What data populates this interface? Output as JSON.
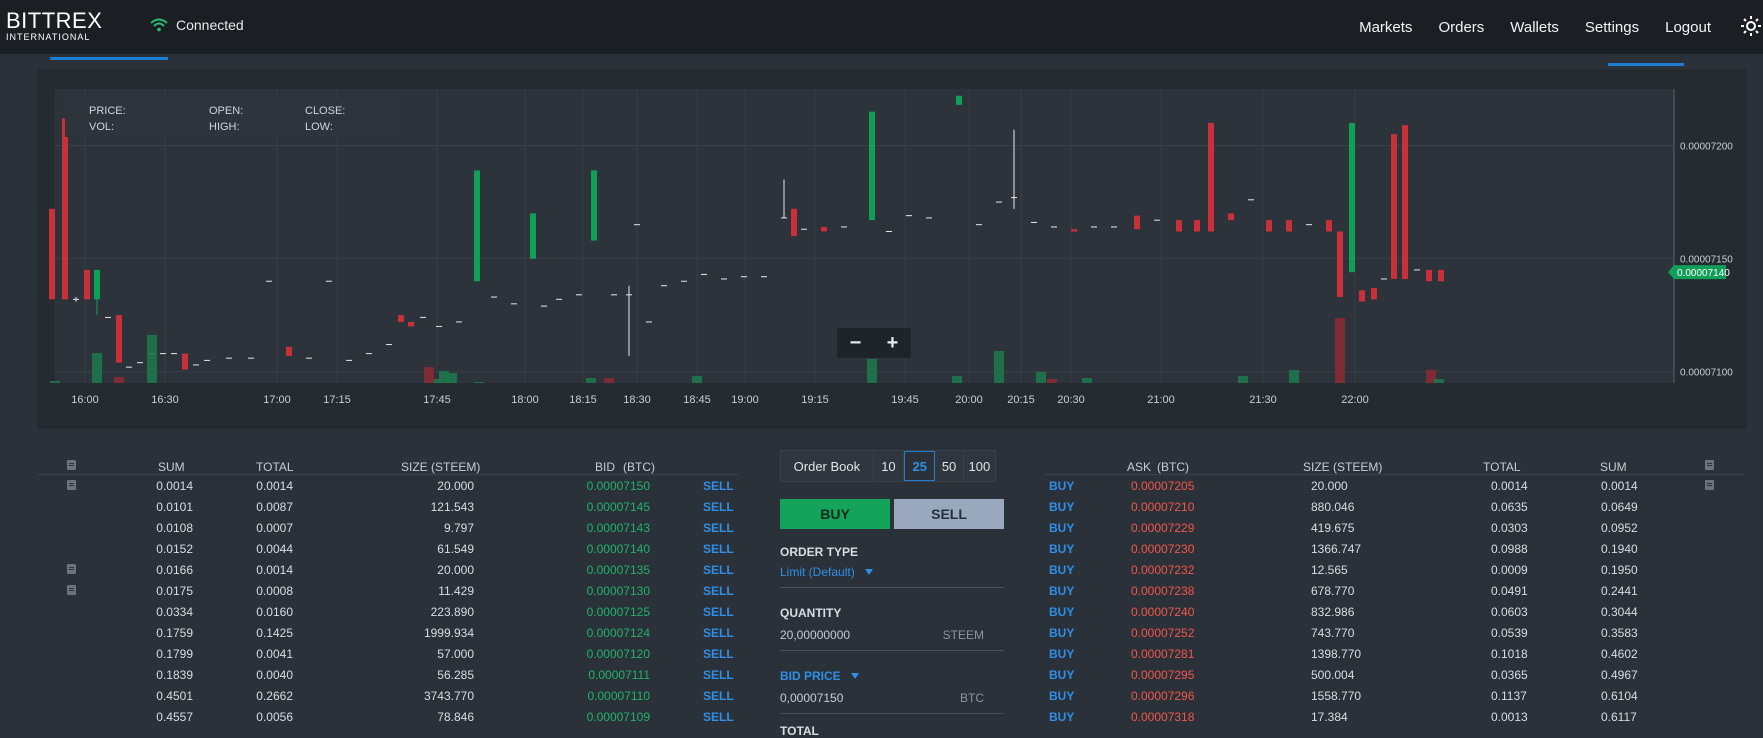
{
  "header": {
    "logo_line1": "BITTREX",
    "logo_line2": "INTERNATIONAL",
    "status": "Connected",
    "nav": [
      "Markets",
      "Orders",
      "Wallets",
      "Settings",
      "Logout"
    ]
  },
  "chart": {
    "legend": {
      "price": "PRICE:",
      "vol": "VOL:",
      "open": "OPEN:",
      "high": "HIGH:",
      "close": "CLOSE:",
      "low": "LOW:"
    },
    "price_labels": [
      "0.00007200",
      "0.00007150",
      "0.00007100"
    ],
    "last_price": "0.00007140",
    "time_labels": [
      "16:00",
      "16:30",
      "17:00",
      "17:15",
      "17:45",
      "18:00",
      "18:15",
      "18:30",
      "18:45",
      "19:00",
      "19:15",
      "19:45",
      "20:00",
      "20:15",
      "20:30",
      "21:00",
      "21:30",
      "22:00"
    ],
    "zoom_out": "−",
    "zoom_in": "+"
  },
  "chart_data": {
    "type": "candlestick",
    "y_range": [
      7.095e-05,
      7.225e-05
    ],
    "candles_note": "",
    "candles": [
      [
        7.17e-05,
        7.132e-05,
        7.172e-05,
        7.132e-05,
        "d"
      ],
      [
        7.212e-05,
        7.132e-05,
        7.212e-05,
        7.132e-05,
        "d"
      ],
      [
        7.132e-05,
        7.132e-05,
        7.133e-05,
        7.131e-05,
        "n"
      ],
      [
        7.145e-05,
        7.132e-05,
        7.145e-05,
        7.132e-05,
        "d"
      ],
      [
        7.132e-05,
        7.145e-05,
        7.145e-05,
        7.13e-05,
        "u"
      ],
      [
        7.124e-05,
        7.124e-05,
        7.124e-05,
        7.124e-05,
        "n"
      ],
      [
        7.122e-05,
        7.104e-05,
        7.122e-05,
        7.104e-05,
        "d"
      ],
      [
        7.102e-05,
        7.102e-05,
        7.102e-05,
        7.102e-05,
        "n"
      ],
      [
        7.104e-05,
        7.104e-05,
        7.104e-05,
        7.104e-05,
        "n"
      ],
      [
        7.108e-05,
        7.108e-05,
        7.108e-05,
        7.108e-05,
        "n"
      ],
      [
        7.146e-05,
        7.146e-05,
        7.146e-05,
        7.146e-05,
        "n"
      ],
      [
        7.108e-05,
        7.101e-05,
        7.108e-05,
        7.101e-05,
        "d"
      ]
    ]
  },
  "bid_table": {
    "headers": [
      "SUM",
      "TOTAL",
      "SIZE (STEEM)",
      "BID",
      "(BTC)"
    ],
    "action": "SELL",
    "rows": [
      {
        "sum": "0.0014",
        "total": "0.0014",
        "size": "20.000",
        "bid": "0.00007150",
        "icon": true
      },
      {
        "sum": "0.0101",
        "total": "0.0087",
        "size": "121.543",
        "bid": "0.00007145",
        "icon": false
      },
      {
        "sum": "0.0108",
        "total": "0.0007",
        "size": "9.797",
        "bid": "0.00007143",
        "icon": false
      },
      {
        "sum": "0.0152",
        "total": "0.0044",
        "size": "61.549",
        "bid": "0.00007140",
        "icon": false
      },
      {
        "sum": "0.0166",
        "total": "0.0014",
        "size": "20.000",
        "bid": "0.00007135",
        "icon": true
      },
      {
        "sum": "0.0175",
        "total": "0.0008",
        "size": "11.429",
        "bid": "0.00007130",
        "icon": true
      },
      {
        "sum": "0.0334",
        "total": "0.0160",
        "size": "223.890",
        "bid": "0.00007125",
        "icon": false
      },
      {
        "sum": "0.1759",
        "total": "0.1425",
        "size": "1999.934",
        "bid": "0.00007124",
        "icon": false
      },
      {
        "sum": "0.1799",
        "total": "0.0041",
        "size": "57.000",
        "bid": "0.00007120",
        "icon": false
      },
      {
        "sum": "0.1839",
        "total": "0.0040",
        "size": "56.285",
        "bid": "0.00007111",
        "icon": false
      },
      {
        "sum": "0.4501",
        "total": "0.2662",
        "size": "3743.770",
        "bid": "0.00007110",
        "icon": false
      },
      {
        "sum": "0.4557",
        "total": "0.0056",
        "size": "78.846",
        "bid": "0.00007109",
        "icon": false
      }
    ]
  },
  "order_form": {
    "orderbook_label": "Order Book",
    "depths": [
      "10",
      "25",
      "50",
      "100"
    ],
    "active_depth": "25",
    "buy": "BUY",
    "sell": "SELL",
    "order_type_label": "ORDER TYPE",
    "order_type_value": "Limit (Default)",
    "quantity_label": "QUANTITY",
    "quantity_value": "20,00000000",
    "quantity_unit": "STEEM",
    "bid_price_label": "BID PRICE",
    "bid_price_value": "0,00007150",
    "bid_price_unit": "BTC",
    "total_label": "TOTAL"
  },
  "ask_table": {
    "headers": [
      "ASK",
      "(BTC)",
      "SIZE (STEEM)",
      "TOTAL",
      "SUM"
    ],
    "action": "BUY",
    "rows": [
      {
        "ask": "0.00007205",
        "size": "20.000",
        "total": "0.0014",
        "sum": "0.0014",
        "icon": true
      },
      {
        "ask": "0.00007210",
        "size": "880.046",
        "total": "0.0635",
        "sum": "0.0649",
        "icon": false
      },
      {
        "ask": "0.00007229",
        "size": "419.675",
        "total": "0.0303",
        "sum": "0.0952",
        "icon": false
      },
      {
        "ask": "0.00007230",
        "size": "1366.747",
        "total": "0.0988",
        "sum": "0.1940",
        "icon": false
      },
      {
        "ask": "0.00007232",
        "size": "12.565",
        "total": "0.0009",
        "sum": "0.1950",
        "icon": false
      },
      {
        "ask": "0.00007238",
        "size": "678.770",
        "total": "0.0491",
        "sum": "0.2441",
        "icon": false
      },
      {
        "ask": "0.00007240",
        "size": "832.986",
        "total": "0.0603",
        "sum": "0.3044",
        "icon": false
      },
      {
        "ask": "0.00007252",
        "size": "743.770",
        "total": "0.0539",
        "sum": "0.3583",
        "icon": false
      },
      {
        "ask": "0.00007281",
        "size": "1398.770",
        "total": "0.1018",
        "sum": "0.4602",
        "icon": false
      },
      {
        "ask": "0.00007295",
        "size": "500.004",
        "total": "0.0365",
        "sum": "0.4967",
        "icon": false
      },
      {
        "ask": "0.00007296",
        "size": "1558.770",
        "total": "0.1137",
        "sum": "0.6104",
        "icon": false
      },
      {
        "ask": "0.00007318",
        "size": "17.384",
        "total": "0.0013",
        "sum": "0.6117",
        "icon": false
      }
    ]
  },
  "colors": {
    "up": "#0f9f57",
    "down": "#c9303a",
    "accent": "#1c7ed6"
  }
}
